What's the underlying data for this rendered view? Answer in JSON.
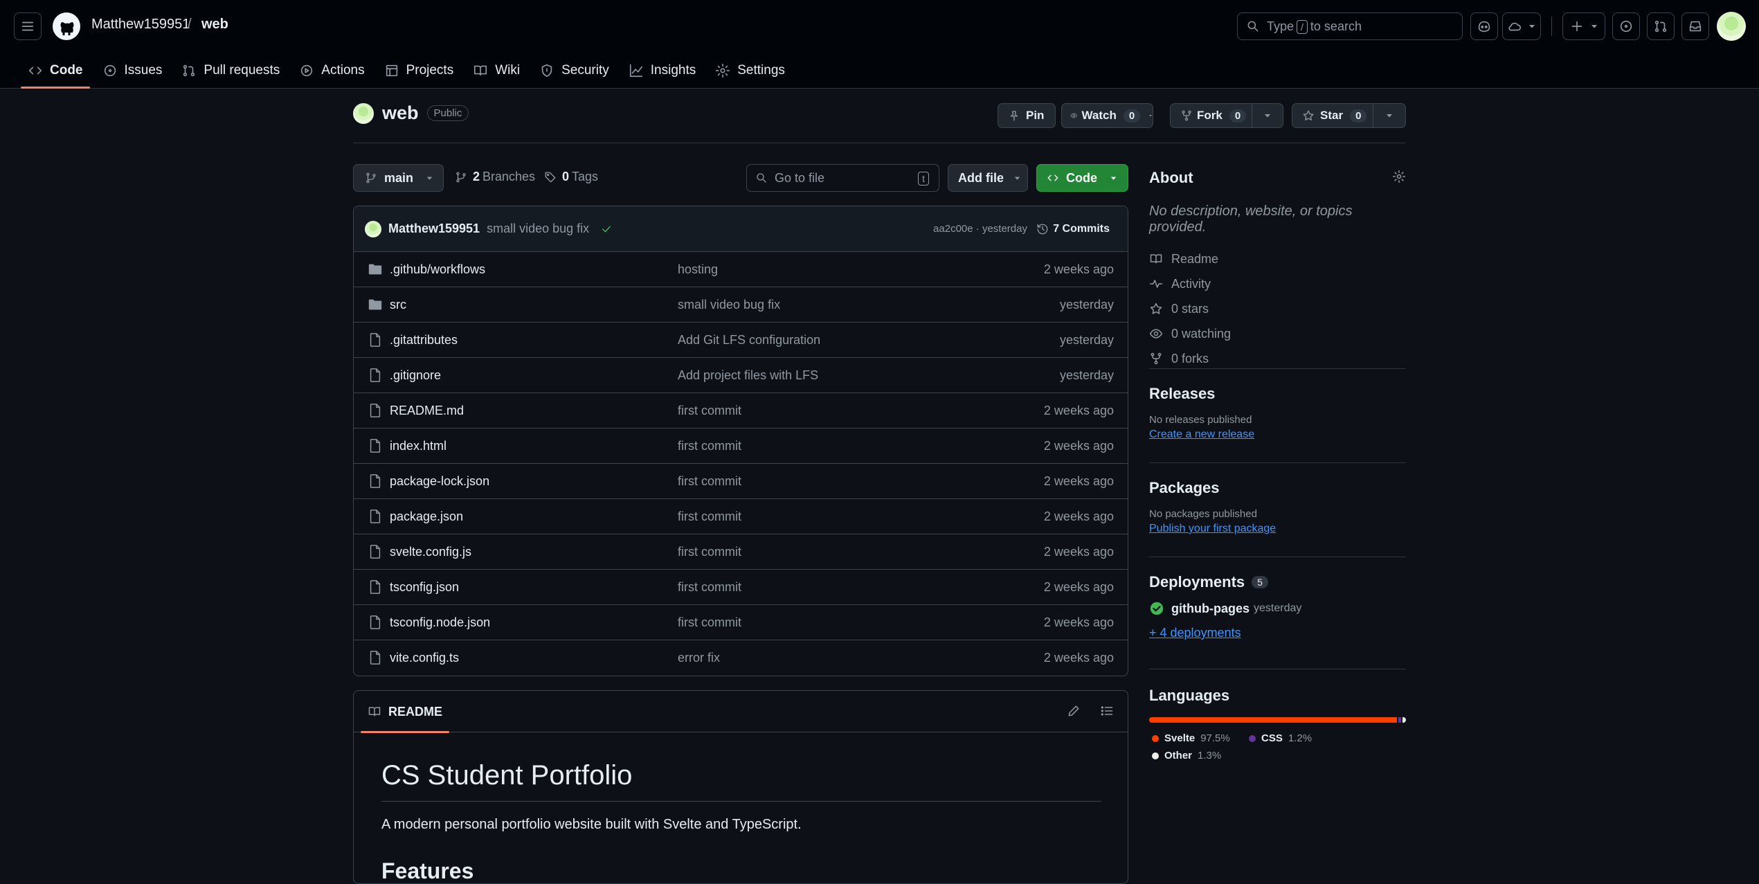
{
  "header": {
    "owner": "Matthew159951",
    "separator": "/",
    "repo": "web",
    "search": {
      "pre": "Type",
      "key": "/",
      "post": "to search"
    }
  },
  "tabs": [
    {
      "label": "Code",
      "icon": "code-icon"
    },
    {
      "label": "Issues",
      "icon": "issue-opened-icon"
    },
    {
      "label": "Pull requests",
      "icon": "git-pull-request-icon"
    },
    {
      "label": "Actions",
      "icon": "play-icon"
    },
    {
      "label": "Projects",
      "icon": "table-icon"
    },
    {
      "label": "Wiki",
      "icon": "book-icon"
    },
    {
      "label": "Security",
      "icon": "shield-icon"
    },
    {
      "label": "Insights",
      "icon": "graph-icon"
    },
    {
      "label": "Settings",
      "icon": "gear-icon"
    }
  ],
  "repo": {
    "name": "web",
    "visibility": "Public",
    "pin": "Pin",
    "watch": "Watch",
    "watch_count": "0",
    "fork": "Fork",
    "fork_count": "0",
    "star": "Star",
    "star_count": "0"
  },
  "toolbar": {
    "branch": "main",
    "branches_count": "2",
    "branches_label": "Branches",
    "tags_count": "0",
    "tags_label": "Tags",
    "goto_placeholder": "Go to file",
    "goto_key": "t",
    "add_file": "Add file",
    "code": "Code"
  },
  "commit": {
    "author": "Matthew159951",
    "message": "small video bug fix",
    "hash": "aa2c00e",
    "dot": "·",
    "when": "yesterday",
    "commits": "7 Commits"
  },
  "files": [
    {
      "name": ".github/workflows",
      "type": "folder",
      "message": "hosting",
      "date": "2 weeks ago"
    },
    {
      "name": "src",
      "type": "folder",
      "message": "small video bug fix",
      "date": "yesterday"
    },
    {
      "name": ".gitattributes",
      "type": "file",
      "message": "Add Git LFS configuration",
      "date": "yesterday"
    },
    {
      "name": ".gitignore",
      "type": "file",
      "message": "Add project files with LFS",
      "date": "yesterday"
    },
    {
      "name": "README.md",
      "type": "file",
      "message": "first commit",
      "date": "2 weeks ago"
    },
    {
      "name": "index.html",
      "type": "file",
      "message": "first commit",
      "date": "2 weeks ago"
    },
    {
      "name": "package-lock.json",
      "type": "file",
      "message": "first commit",
      "date": "2 weeks ago"
    },
    {
      "name": "package.json",
      "type": "file",
      "message": "first commit",
      "date": "2 weeks ago"
    },
    {
      "name": "svelte.config.js",
      "type": "file",
      "message": "first commit",
      "date": "2 weeks ago"
    },
    {
      "name": "tsconfig.json",
      "type": "file",
      "message": "first commit",
      "date": "2 weeks ago"
    },
    {
      "name": "tsconfig.node.json",
      "type": "file",
      "message": "first commit",
      "date": "2 weeks ago"
    },
    {
      "name": "vite.config.ts",
      "type": "file",
      "message": "error fix",
      "date": "2 weeks ago"
    }
  ],
  "readme": {
    "tab": "README",
    "title": "CS Student Portfolio",
    "description": "A modern personal portfolio website built with Svelte and TypeScript.",
    "section": "Features"
  },
  "about": {
    "title": "About",
    "description": "No description, website, or topics provided.",
    "readme": "Readme",
    "activity": "Activity",
    "stars": "0 stars",
    "watching": "0 watching",
    "forks": "0 forks"
  },
  "releases": {
    "title": "Releases",
    "empty": "No releases published",
    "link": "Create a new release"
  },
  "packages": {
    "title": "Packages",
    "empty": "No packages published",
    "link": "Publish your first package"
  },
  "deployments": {
    "title": "Deployments",
    "count": "5",
    "env": "github-pages",
    "when": "yesterday",
    "more": "+ 4 deployments"
  },
  "languages": {
    "title": "Languages",
    "items": [
      {
        "name": "Svelte",
        "percent": "97.5%",
        "value": 97.5,
        "color": "#ff3e00"
      },
      {
        "name": "CSS",
        "percent": "1.2%",
        "value": 1.2,
        "color": "#663399"
      },
      {
        "name": "Other",
        "percent": "1.3%",
        "value": 1.3,
        "color": "#ededed"
      }
    ]
  },
  "colors": {
    "accent": "#f78166",
    "green": "#238636",
    "link": "#4493f8",
    "success": "#3fb950"
  }
}
